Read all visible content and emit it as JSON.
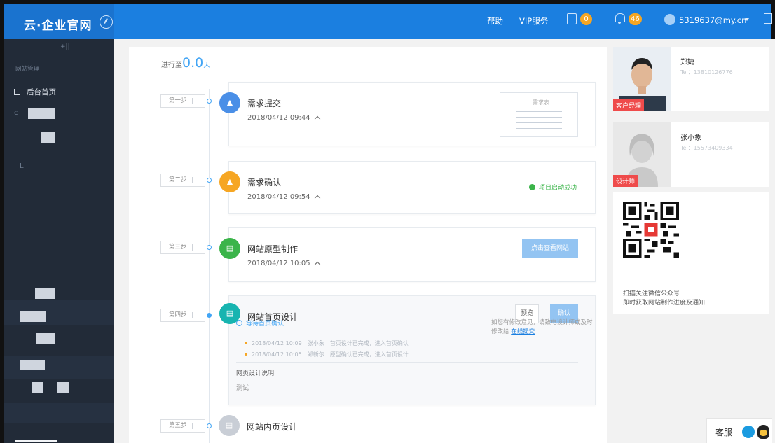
{
  "header": {
    "logo": "云·企业官网",
    "help": "帮助",
    "vip": "VIP服务",
    "notes_badge": "0",
    "alerts_badge": "46",
    "user": "5319637@my.cn"
  },
  "sidebar": {
    "section": "网站管理",
    "home": "后台首页"
  },
  "progress": {
    "prefix": "进行至",
    "value": "0.0",
    "unit": "天"
  },
  "steps": [
    {
      "label": "第一步",
      "title": "需求提交",
      "date": "2018/04/12 09:44",
      "preview_title": "需求表"
    },
    {
      "label": "第二步",
      "title": "需求确认",
      "date": "2018/04/12 09:54",
      "status": "项目启动成功"
    },
    {
      "label": "第三步",
      "title": "网站原型制作",
      "date": "2018/04/12 10:05",
      "action": "点击查看网站"
    },
    {
      "label": "第四步",
      "title": "网站首页设计",
      "preview": "预览",
      "confirm": "确认",
      "waiting": "等待首页确认",
      "log": [
        {
          "time": "2018/04/12 10:09",
          "person": "张小象",
          "text": "首页设计已完成，进入首页确认"
        },
        {
          "time": "2018/04/12 10:05",
          "person": "郑新尔",
          "text": "原型确认已完成，进入首页设计"
        }
      ],
      "note": "如您有修改意见，请致电设计师或及时修改给",
      "note_link": "在线提交",
      "desc_label": "网页设计说明:",
      "desc_value": "测试"
    },
    {
      "label": "第五步",
      "title": "网站内页设计"
    }
  ],
  "staff": [
    {
      "name": "郑婕",
      "tel": "Tel：13810126776",
      "tag": "客户经理"
    },
    {
      "name": "张小象",
      "tel": "Tel：15573409334",
      "tag": "设计师"
    }
  ],
  "qr": {
    "line1": "扫描关注微信公众号",
    "line2": "即时获取网站制作进度及通知"
  },
  "service": {
    "label": "客服"
  },
  "colors": {
    "brand": "#1b7fe0",
    "step1": "#4a8fe7",
    "step2": "#f6a623",
    "step3": "#3bb44a",
    "step4": "#17b4b0",
    "step5": "#c9ced6"
  }
}
